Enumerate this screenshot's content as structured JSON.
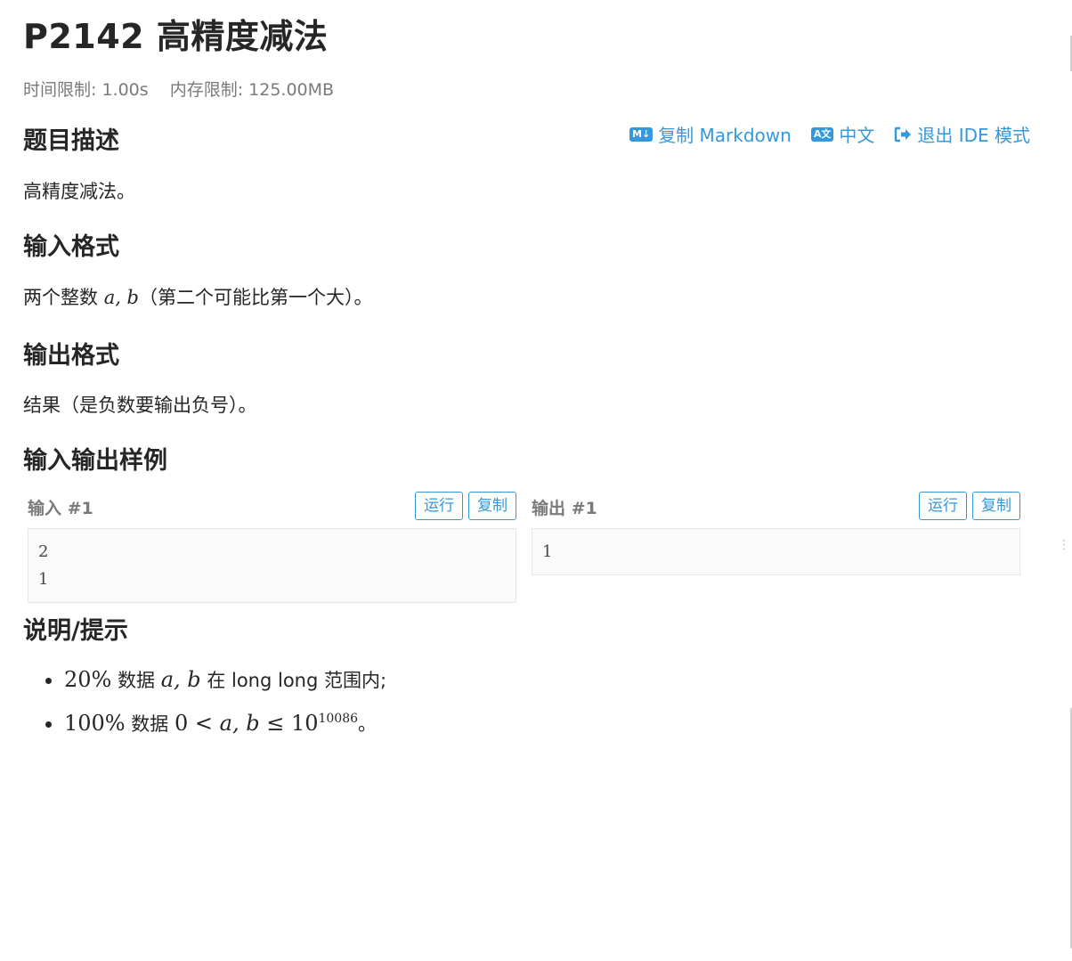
{
  "problem": {
    "title": "P2142 高精度减法",
    "time_limit": "时间限制: 1.00s",
    "memory_limit": "内存限制: 125.00MB"
  },
  "toolbar": {
    "copy_markdown": "复制 Markdown",
    "copy_markdown_icon": "M↓",
    "language": "中文",
    "language_icon": "A文",
    "exit_ide": "退出 IDE 模式"
  },
  "sections": {
    "description_title": "题目描述",
    "description_text": "高精度减法。",
    "input_title": "输入格式",
    "input_prefix": "两个整数 ",
    "input_vars": "a, b",
    "input_suffix": "（第二个可能比第一个大）。",
    "output_title": "输出格式",
    "output_text": "结果（是负数要输出负号）。",
    "samples_title": "输入输出样例",
    "hints_title": "说明/提示"
  },
  "samples": {
    "input_label": "输入 #1",
    "output_label": "输出 #1",
    "run_label": "运行",
    "copy_label": "复制",
    "input_lines": [
      "2",
      "1"
    ],
    "output_lines": [
      "1"
    ]
  },
  "hints": {
    "h1_pct": "20%",
    "h1_mid": " 数据 ",
    "h1_vars": "a, b",
    "h1_end": " 在 long long 范围内;",
    "h2_pct": "100%",
    "h2_mid": " 数据 ",
    "h2_zero": "0 <",
    "h2_vars": "a, b",
    "h2_le": " ≤ 10",
    "h2_exp": "10086",
    "h2_end": "。"
  },
  "colors": {
    "link": "#3498db",
    "muted": "#7a7a7a",
    "text": "#262626"
  }
}
